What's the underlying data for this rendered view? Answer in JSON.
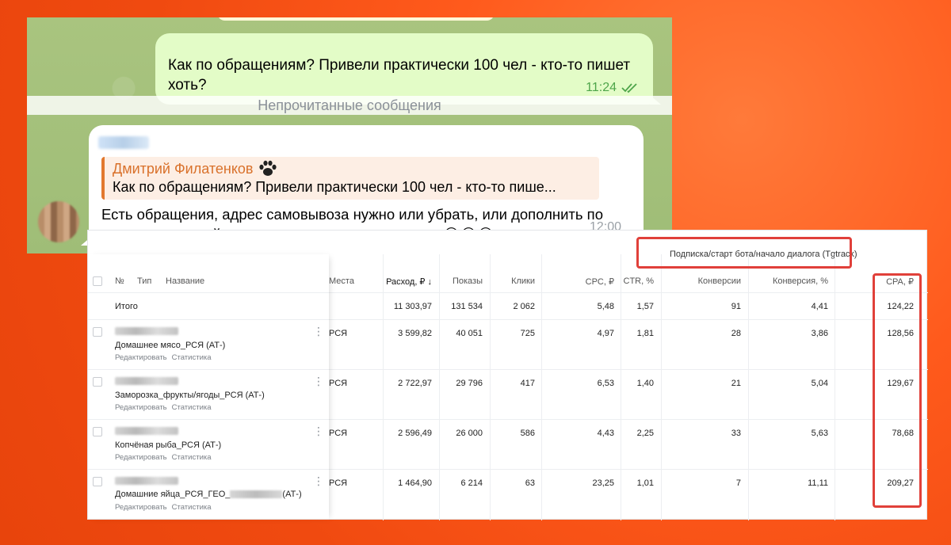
{
  "chat": {
    "outgoing": {
      "text": "Как по обращениям? Привели практически 100 чел - кто-то пишет хоть?",
      "time": "11:24",
      "status_icon": "double-check-icon"
    },
    "unread_divider": "Непрочитанные сообщения",
    "incoming": {
      "reply_author": "Дмитрий Филатенков",
      "reply_author_icon": "paw-icon",
      "reply_quote": "Как по обращениям? Привели практически 100 чел - кто-то пише...",
      "text": "Есть обращения, адрес самовывоза нужно или убрать, или дополнить по предварительной записи, потому что люди пошли😂😂😂",
      "time": "12:00"
    }
  },
  "table": {
    "group_header": "Подписка/старт бота/начало диалога (Tgtrack)",
    "columns": {
      "num": "№",
      "type": "Тип",
      "name": "Название",
      "places": "Места",
      "spend": "Расход, ₽ ↓",
      "impressions": "Показы",
      "clicks": "Клики",
      "cpc": "CPC, ₽",
      "ctr": "CTR, %",
      "conversions": "Конверсии",
      "conv_rate": "Конверсия, %",
      "cpa": "CPA, ₽"
    },
    "total": {
      "label": "Итого",
      "spend": "11 303,97",
      "impressions": "131 534",
      "clicks": "2 062",
      "cpc": "5,48",
      "ctr": "1,57",
      "conversions": "91",
      "conv_rate": "4,41",
      "cpa": "124,22"
    },
    "rows": [
      {
        "name": "Домашнее мясо_РСЯ (АТ-)",
        "place": "РСЯ",
        "spend": "3 599,82",
        "impressions": "40 051",
        "clicks": "725",
        "cpc": "4,97",
        "ctr": "1,81",
        "conversions": "28",
        "conv_rate": "3,86",
        "cpa": "128,56"
      },
      {
        "name": "Заморозка_фрукты/ягоды_РСЯ (АТ-)",
        "place": "РСЯ",
        "spend": "2 722,97",
        "impressions": "29 796",
        "clicks": "417",
        "cpc": "6,53",
        "ctr": "1,40",
        "conversions": "21",
        "conv_rate": "5,04",
        "cpa": "129,67"
      },
      {
        "name": "Копчёная рыба_РСЯ (АТ-)",
        "place": "РСЯ",
        "spend": "2 596,49",
        "impressions": "26 000",
        "clicks": "586",
        "cpc": "4,43",
        "ctr": "2,25",
        "conversions": "33",
        "conv_rate": "5,63",
        "cpa": "78,68"
      },
      {
        "name_prefix": "Домашние яйца_РСЯ_ГЕО_",
        "name_suffix": "(АТ-)",
        "place": "РСЯ",
        "spend": "1 464,90",
        "impressions": "6 214",
        "clicks": "63",
        "cpc": "23,25",
        "ctr": "1,01",
        "conversions": "7",
        "conv_rate": "11,11",
        "cpa": "209,27"
      }
    ],
    "row_links": {
      "edit": "Редактировать",
      "stats": "Статистика"
    }
  }
}
